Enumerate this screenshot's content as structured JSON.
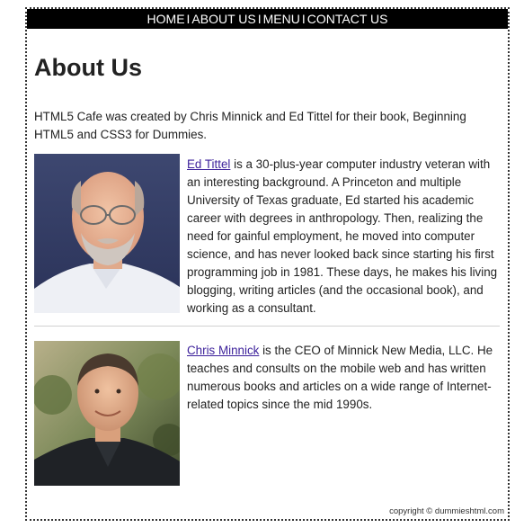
{
  "nav": {
    "items": [
      "HOME",
      "ABOUT US",
      "MENU",
      "CONTACT US"
    ],
    "separator": "I"
  },
  "page": {
    "title": "About Us",
    "intro": "HTML5 Cafe was created by Chris Minnick and Ed Tittel for their book, Beginning HTML5 and CSS3 for Dummies."
  },
  "profiles": [
    {
      "name": "Ed Tittel",
      "bio": " is a 30-plus-year computer industry veteran with an interesting background. A Princeton and multiple University of Texas graduate, Ed started his academic career with degrees in anthropology. Then, realizing the need for gainful employment, he moved into computer science, and has never looked back since starting his first programming job in 1981. These days, he makes his living blogging, writing articles (and the occasional book), and working as a consultant."
    },
    {
      "name": "Chris Minnick",
      "bio": " is the CEO of Minnick New Media, LLC. He teaches and consults on the mobile web and has written numerous books and articles on a wide range of Internet-related topics since the mid 1990s."
    }
  ],
  "footer": {
    "copyright": "copyright © dummieshtml.com"
  }
}
